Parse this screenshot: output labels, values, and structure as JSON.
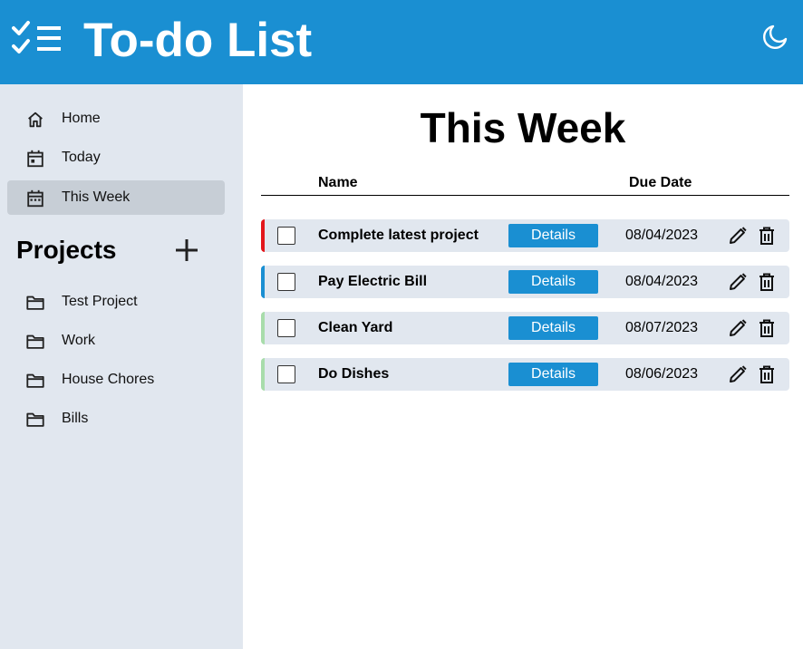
{
  "header": {
    "title": "To-do List",
    "logo_icon": "checklist-icon",
    "theme_icon": "moon-icon"
  },
  "sidebar": {
    "nav": [
      {
        "label": "Home",
        "icon": "home-icon",
        "active": false
      },
      {
        "label": "Today",
        "icon": "calendar-icon",
        "active": false
      },
      {
        "label": "This Week",
        "icon": "calendar-week-icon",
        "active": true
      }
    ],
    "projects_title": "Projects",
    "projects": [
      {
        "label": "Test Project",
        "icon": "folder-icon"
      },
      {
        "label": "Work",
        "icon": "folder-icon"
      },
      {
        "label": "House Chores",
        "icon": "folder-icon"
      },
      {
        "label": "Bills",
        "icon": "folder-icon"
      }
    ]
  },
  "main": {
    "title": "This Week",
    "columns": {
      "name": "Name",
      "due_date": "Due Date"
    },
    "tasks": [
      {
        "name": "Complete latest project",
        "details_label": "Details",
        "due_date": "08/04/2023",
        "priority_color": "#e3161b"
      },
      {
        "name": "Pay Electric Bill",
        "details_label": "Details",
        "due_date": "08/04/2023",
        "priority_color": "#1a8fd2"
      },
      {
        "name": "Clean Yard",
        "details_label": "Details",
        "due_date": "08/07/2023",
        "priority_color": "#a8dcab"
      },
      {
        "name": "Do Dishes",
        "details_label": "Details",
        "due_date": "08/06/2023",
        "priority_color": "#a8dcab"
      }
    ]
  },
  "colors": {
    "accent": "#1a8fd2",
    "sidebar_bg": "#e1e7ef",
    "active_nav": "#c7ced6"
  }
}
